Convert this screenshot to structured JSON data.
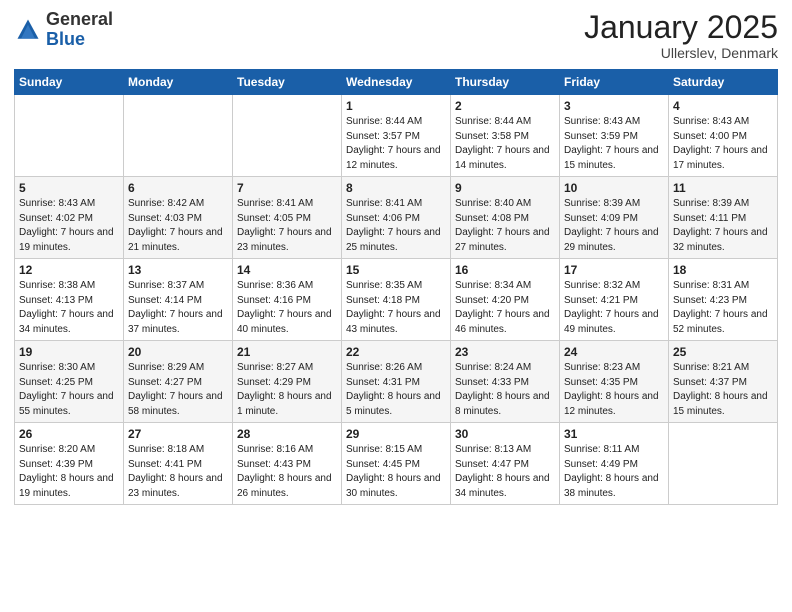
{
  "logo": {
    "general": "General",
    "blue": "Blue"
  },
  "header": {
    "month": "January 2025",
    "location": "Ullerslev, Denmark"
  },
  "days_of_week": [
    "Sunday",
    "Monday",
    "Tuesday",
    "Wednesday",
    "Thursday",
    "Friday",
    "Saturday"
  ],
  "weeks": [
    [
      {
        "num": "",
        "info": ""
      },
      {
        "num": "",
        "info": ""
      },
      {
        "num": "",
        "info": ""
      },
      {
        "num": "1",
        "info": "Sunrise: 8:44 AM\nSunset: 3:57 PM\nDaylight: 7 hours\nand 12 minutes."
      },
      {
        "num": "2",
        "info": "Sunrise: 8:44 AM\nSunset: 3:58 PM\nDaylight: 7 hours\nand 14 minutes."
      },
      {
        "num": "3",
        "info": "Sunrise: 8:43 AM\nSunset: 3:59 PM\nDaylight: 7 hours\nand 15 minutes."
      },
      {
        "num": "4",
        "info": "Sunrise: 8:43 AM\nSunset: 4:00 PM\nDaylight: 7 hours\nand 17 minutes."
      }
    ],
    [
      {
        "num": "5",
        "info": "Sunrise: 8:43 AM\nSunset: 4:02 PM\nDaylight: 7 hours\nand 19 minutes."
      },
      {
        "num": "6",
        "info": "Sunrise: 8:42 AM\nSunset: 4:03 PM\nDaylight: 7 hours\nand 21 minutes."
      },
      {
        "num": "7",
        "info": "Sunrise: 8:41 AM\nSunset: 4:05 PM\nDaylight: 7 hours\nand 23 minutes."
      },
      {
        "num": "8",
        "info": "Sunrise: 8:41 AM\nSunset: 4:06 PM\nDaylight: 7 hours\nand 25 minutes."
      },
      {
        "num": "9",
        "info": "Sunrise: 8:40 AM\nSunset: 4:08 PM\nDaylight: 7 hours\nand 27 minutes."
      },
      {
        "num": "10",
        "info": "Sunrise: 8:39 AM\nSunset: 4:09 PM\nDaylight: 7 hours\nand 29 minutes."
      },
      {
        "num": "11",
        "info": "Sunrise: 8:39 AM\nSunset: 4:11 PM\nDaylight: 7 hours\nand 32 minutes."
      }
    ],
    [
      {
        "num": "12",
        "info": "Sunrise: 8:38 AM\nSunset: 4:13 PM\nDaylight: 7 hours\nand 34 minutes."
      },
      {
        "num": "13",
        "info": "Sunrise: 8:37 AM\nSunset: 4:14 PM\nDaylight: 7 hours\nand 37 minutes."
      },
      {
        "num": "14",
        "info": "Sunrise: 8:36 AM\nSunset: 4:16 PM\nDaylight: 7 hours\nand 40 minutes."
      },
      {
        "num": "15",
        "info": "Sunrise: 8:35 AM\nSunset: 4:18 PM\nDaylight: 7 hours\nand 43 minutes."
      },
      {
        "num": "16",
        "info": "Sunrise: 8:34 AM\nSunset: 4:20 PM\nDaylight: 7 hours\nand 46 minutes."
      },
      {
        "num": "17",
        "info": "Sunrise: 8:32 AM\nSunset: 4:21 PM\nDaylight: 7 hours\nand 49 minutes."
      },
      {
        "num": "18",
        "info": "Sunrise: 8:31 AM\nSunset: 4:23 PM\nDaylight: 7 hours\nand 52 minutes."
      }
    ],
    [
      {
        "num": "19",
        "info": "Sunrise: 8:30 AM\nSunset: 4:25 PM\nDaylight: 7 hours\nand 55 minutes."
      },
      {
        "num": "20",
        "info": "Sunrise: 8:29 AM\nSunset: 4:27 PM\nDaylight: 7 hours\nand 58 minutes."
      },
      {
        "num": "21",
        "info": "Sunrise: 8:27 AM\nSunset: 4:29 PM\nDaylight: 8 hours\nand 1 minute."
      },
      {
        "num": "22",
        "info": "Sunrise: 8:26 AM\nSunset: 4:31 PM\nDaylight: 8 hours\nand 5 minutes."
      },
      {
        "num": "23",
        "info": "Sunrise: 8:24 AM\nSunset: 4:33 PM\nDaylight: 8 hours\nand 8 minutes."
      },
      {
        "num": "24",
        "info": "Sunrise: 8:23 AM\nSunset: 4:35 PM\nDaylight: 8 hours\nand 12 minutes."
      },
      {
        "num": "25",
        "info": "Sunrise: 8:21 AM\nSunset: 4:37 PM\nDaylight: 8 hours\nand 15 minutes."
      }
    ],
    [
      {
        "num": "26",
        "info": "Sunrise: 8:20 AM\nSunset: 4:39 PM\nDaylight: 8 hours\nand 19 minutes."
      },
      {
        "num": "27",
        "info": "Sunrise: 8:18 AM\nSunset: 4:41 PM\nDaylight: 8 hours\nand 23 minutes."
      },
      {
        "num": "28",
        "info": "Sunrise: 8:16 AM\nSunset: 4:43 PM\nDaylight: 8 hours\nand 26 minutes."
      },
      {
        "num": "29",
        "info": "Sunrise: 8:15 AM\nSunset: 4:45 PM\nDaylight: 8 hours\nand 30 minutes."
      },
      {
        "num": "30",
        "info": "Sunrise: 8:13 AM\nSunset: 4:47 PM\nDaylight: 8 hours\nand 34 minutes."
      },
      {
        "num": "31",
        "info": "Sunrise: 8:11 AM\nSunset: 4:49 PM\nDaylight: 8 hours\nand 38 minutes."
      },
      {
        "num": "",
        "info": ""
      }
    ]
  ]
}
